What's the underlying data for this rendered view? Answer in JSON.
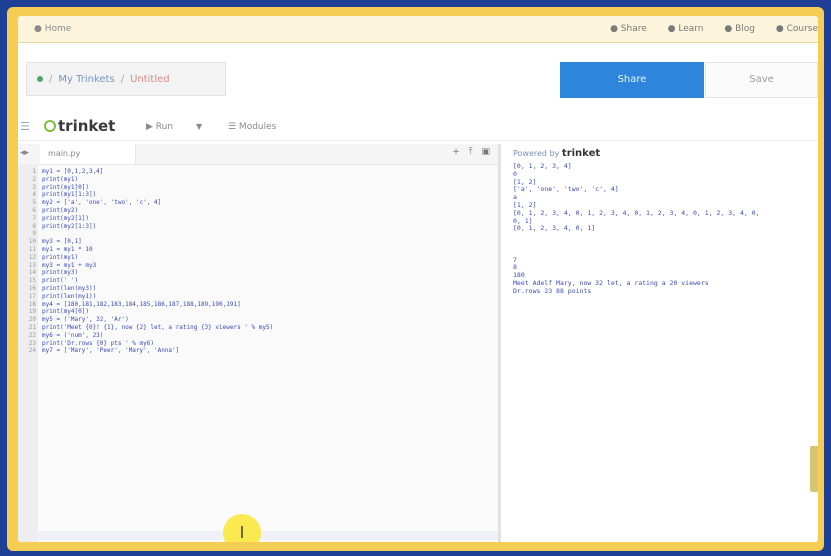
{
  "nav": {
    "home": "● Home",
    "right_items": [
      "● Share",
      "● Learn",
      "● Blog",
      "● Course"
    ]
  },
  "breadcrumb": {
    "parent": "My Trinkets",
    "current": "Untitled"
  },
  "actions": {
    "primary": "Share",
    "secondary": "Save"
  },
  "toolbar": {
    "logo": "trinket",
    "run": "▶ Run",
    "modules": "☰ Modules"
  },
  "editor": {
    "filename": "main.py",
    "lines": [
      "my1 = [0,1,2,3,4]",
      "print(my1)",
      "print(my1[0])",
      "print(my1[1:3])",
      "my2 = ['a', 'one', 'two', 'c', 4]",
      "print(my2)",
      "print(my2[1])",
      "print(my2[1:3])",
      "",
      "my3 = [0,1]",
      "my1 = my1 * 10",
      "print(my1)",
      "my3 = my1 + my3",
      "print(my3)",
      "print(' ')",
      "print(len(my3))",
      "print(len(my1))",
      "my4 = [180,181,182,183,184,185,186,187,188,189,190,191]",
      "print(my4[0])",
      "my5 = ('Mary', 32, 'Ar')",
      "print('Meet {0}! {1}, now {2} let, a rating {3} viewers ' % my5)",
      "my6 = ('num', 23)",
      "print('Dr.rows {0} pts ' % my6)",
      "my7 = ['Mary', 'Peer', 'Mary', 'Anna']"
    ]
  },
  "output": {
    "powered_by": "Powered by",
    "brand": "trinket",
    "lines": [
      "[0, 1, 2, 3, 4]",
      "0",
      "[1, 2]",
      "['a', 'one', 'two', 'c', 4]",
      "a",
      "[1, 2]",
      "[0, 1, 2, 3, 4, 0, 1, 2, 3, 4, 0, 1, 2, 3, 4, 0, 1, 2, 3, 4, 0,",
      "0, 1]",
      "[0, 1, 2, 3, 4, 0, 1]",
      "",
      "",
      "",
      "7",
      "8",
      "180",
      "Meet Adelf Mary, now 32 let, a rating a 20 viewers",
      "Dr.rows 23 88 points"
    ]
  }
}
